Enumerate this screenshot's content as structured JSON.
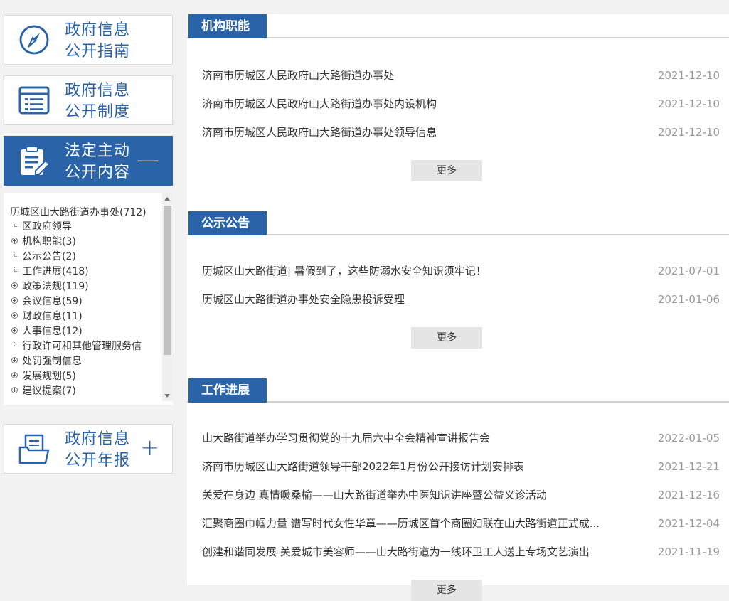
{
  "sidebar": {
    "guide": {
      "line1": "政府信息",
      "line2": "公开指南"
    },
    "system": {
      "line1": "政府信息",
      "line2": "公开制度"
    },
    "statutory": {
      "line1": "法定主动",
      "line2": "公开内容",
      "toggle": "—"
    },
    "annual": {
      "line1": "政府信息",
      "line2": "公开年报",
      "toggle": "+"
    },
    "tree": {
      "root": "历城区山大路街道办事处(712)",
      "items": [
        {
          "label": "区政府领导",
          "expandable": false
        },
        {
          "label": "机构职能(3)",
          "expandable": true
        },
        {
          "label": "公示公告(2)",
          "expandable": false
        },
        {
          "label": "工作进展(418)",
          "expandable": false
        },
        {
          "label": "政策法规(119)",
          "expandable": true
        },
        {
          "label": "会议信息(59)",
          "expandable": true
        },
        {
          "label": "财政信息(11)",
          "expandable": true
        },
        {
          "label": "人事信息(12)",
          "expandable": true
        },
        {
          "label": "行政许可和其他管理服务信",
          "expandable": false
        },
        {
          "label": "处罚强制信息",
          "expandable": true
        },
        {
          "label": "发展规划(5)",
          "expandable": true
        },
        {
          "label": "建议提案(7)",
          "expandable": true
        }
      ]
    }
  },
  "sections": [
    {
      "title": "机构职能",
      "more": "更多",
      "items": [
        {
          "title": "济南市历城区人民政府山大路街道办事处",
          "date": "2021-12-10"
        },
        {
          "title": "济南市历城区人民政府山大路街道办事处内设机构",
          "date": "2021-12-10"
        },
        {
          "title": "济南市历城区人民政府山大路街道办事处领导信息",
          "date": "2021-12-10"
        }
      ]
    },
    {
      "title": "公示公告",
      "more": "更多",
      "items": [
        {
          "title": "历城区山大路街道| 暑假到了，这些防溺水安全知识须牢记！",
          "date": "2021-07-01"
        },
        {
          "title": "历城区山大路街道办事处安全隐患投诉受理",
          "date": "2021-01-06"
        }
      ]
    },
    {
      "title": "工作进展",
      "more": "更多",
      "items": [
        {
          "title": "山大路街道举办学习贯彻党的十九届六中全会精神宣讲报告会",
          "date": "2022-01-05"
        },
        {
          "title": "济南市历城区山大路街道领导干部2022年1月份公开接访计划安排表",
          "date": "2021-12-21"
        },
        {
          "title": "关爱在身边 真情暖桑榆——山大路街道举办中医知识讲座暨公益义诊活动",
          "date": "2021-12-16"
        },
        {
          "title": "汇聚商圈巾帼力量 谱写时代女性华章——历城区首个商圈妇联在山大路街道正式成...",
          "date": "2021-12-04"
        },
        {
          "title": "创建和谐同发展 关爱城市美容师——山大路街道为一线环卫工人送上专场文艺演出",
          "date": "2021-11-19"
        }
      ]
    }
  ],
  "colors": {
    "accent": "#2a63a8",
    "date": "#999999"
  }
}
